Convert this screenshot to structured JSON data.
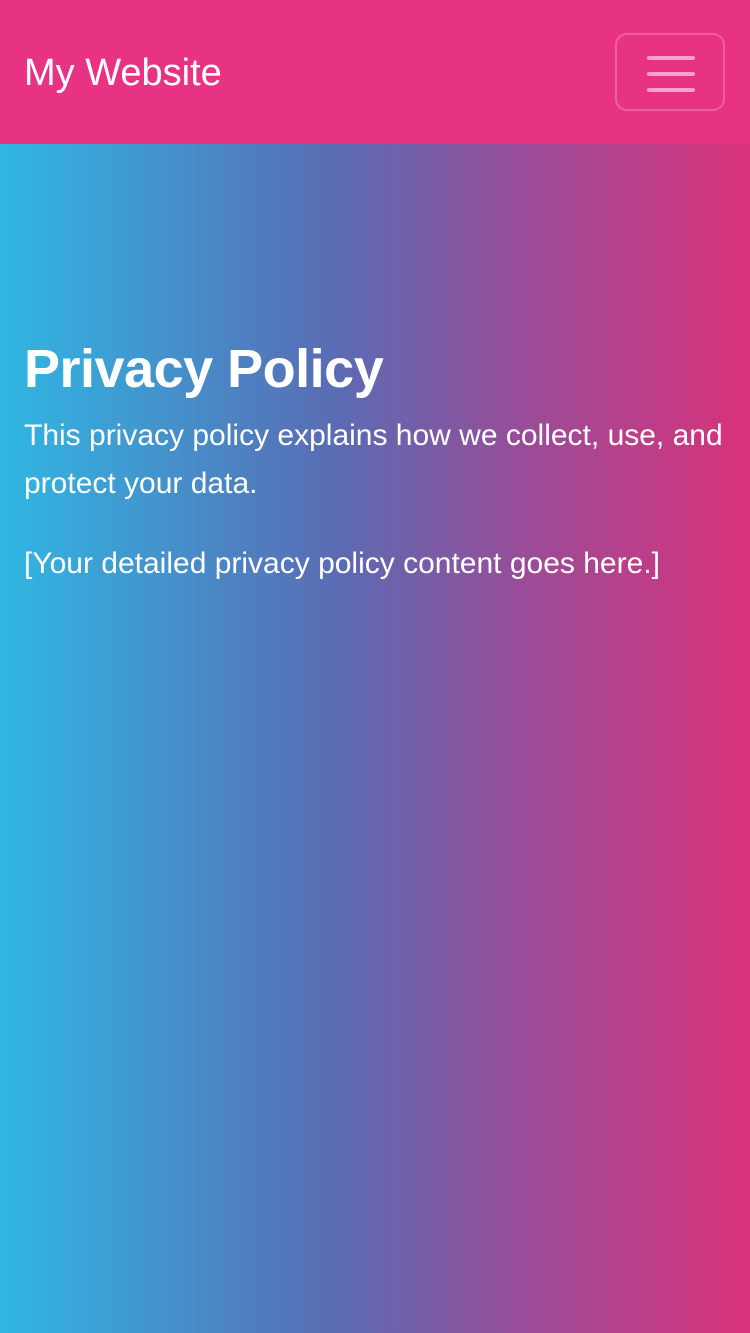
{
  "navbar": {
    "brand": "My Website",
    "toggler_icon": "hamburger-menu-icon"
  },
  "main": {
    "title": "Privacy Policy",
    "intro": "This privacy policy explains how we collect, use, and protect your data.",
    "placeholder": "[Your detailed privacy policy content goes here.]"
  },
  "colors": {
    "navbar_bg": "#e83385",
    "gradient_start": "#2fb7e3",
    "gradient_end": "#d9327b",
    "text": "#ffffff"
  }
}
